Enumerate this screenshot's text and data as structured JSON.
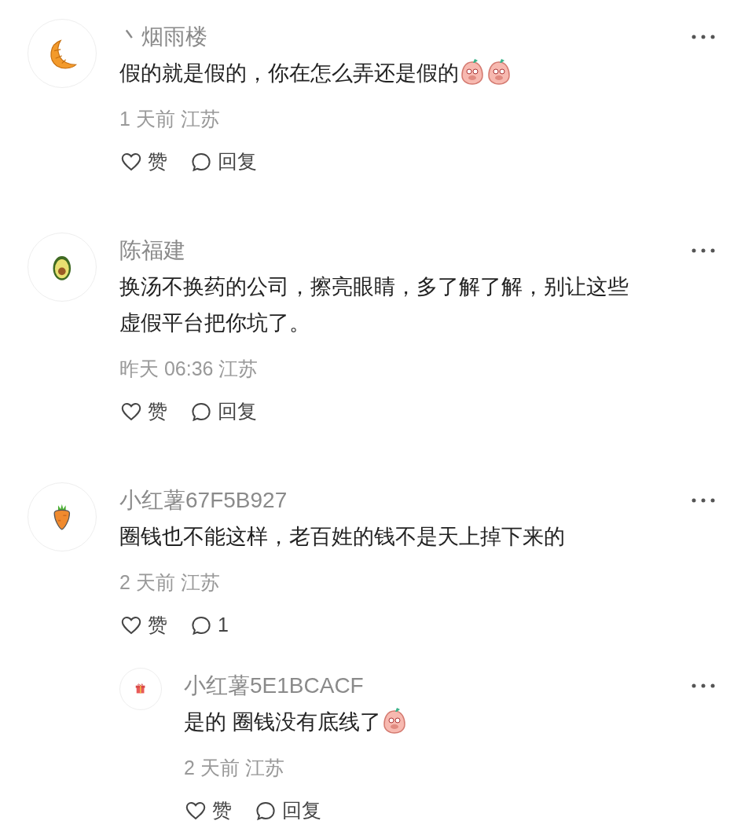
{
  "comments": [
    {
      "avatar": {
        "kind": "croissant"
      },
      "name": "丶烟雨楼",
      "content": [
        {
          "kind": "text",
          "text": "假的就是假的，你在怎么弄还是假的"
        },
        {
          "kind": "emoji"
        },
        {
          "kind": "emoji"
        }
      ],
      "meta": "1 天前 江苏",
      "like_label": "赞",
      "reply_label": "回复"
    },
    {
      "avatar": {
        "kind": "avocado"
      },
      "name": "陈福建",
      "content": [
        {
          "kind": "text",
          "text": "换汤不换药的公司，擦亮眼睛，多了解了解，别让这些虚假平台把你坑了。"
        }
      ],
      "meta": "昨天 06:36 江苏",
      "like_label": "赞",
      "reply_label": "回复"
    },
    {
      "avatar": {
        "kind": "carrot"
      },
      "name": "小红薯67F5B927",
      "content": [
        {
          "kind": "text",
          "text": "圈钱也不能这样，老百姓的钱不是天上掉下来的"
        }
      ],
      "meta": "2 天前 江苏",
      "like_label": "赞",
      "reply_label": "1",
      "replies": [
        {
          "avatar": {
            "kind": "gift"
          },
          "name": "小红薯5E1BCACF",
          "content": [
            {
              "kind": "text",
              "text": "是的 圈钱没有底线了"
            },
            {
              "kind": "emoji"
            }
          ],
          "meta": "2 天前 江苏",
          "like_label": "赞",
          "reply_label": "回复"
        }
      ]
    }
  ]
}
